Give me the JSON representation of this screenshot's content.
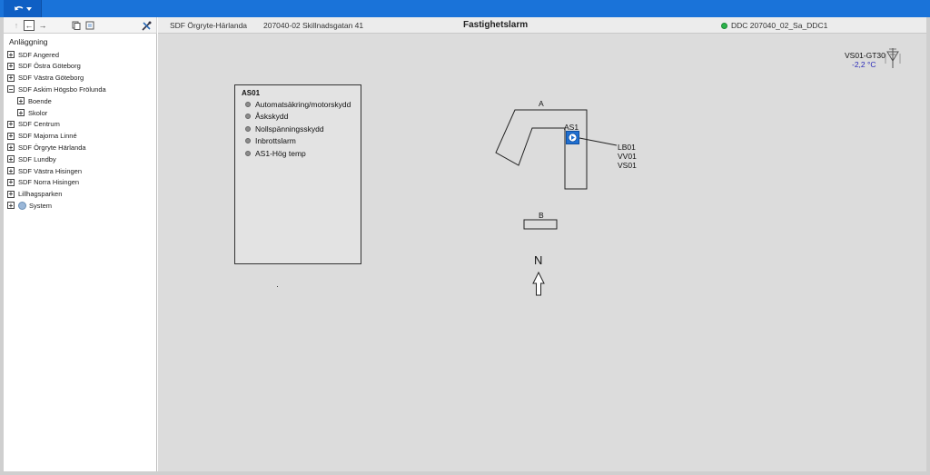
{
  "toolbar": {
    "up": "↑",
    "back": "←",
    "forward": "→"
  },
  "tree": {
    "root": "Anläggning",
    "items": [
      {
        "label": "SDF Angered",
        "exp": "+"
      },
      {
        "label": "SDF Östra Göteborg",
        "exp": "+"
      },
      {
        "label": "SDF Västra Göteborg",
        "exp": "+"
      },
      {
        "label": "SDF Askim Högsbo Frölunda",
        "exp": "−"
      },
      {
        "label": "Boende",
        "exp": "+"
      },
      {
        "label": "Skolor",
        "exp": "+"
      },
      {
        "label": "SDF Centrum",
        "exp": "+"
      },
      {
        "label": "SDF Majorna Linné",
        "exp": "+"
      },
      {
        "label": "SDF Örgryte Härlanda",
        "exp": "+"
      },
      {
        "label": "SDF Lundby",
        "exp": "+"
      },
      {
        "label": "SDF Västra Hisingen",
        "exp": "+"
      },
      {
        "label": "SDF Norra Hisingen",
        "exp": "+"
      },
      {
        "label": "Lillhagsparken",
        "exp": "+"
      },
      {
        "label": "System",
        "exp": "+"
      }
    ]
  },
  "header": {
    "site": "SDF Örgryte-Härlanda",
    "address": "207040-02 Skillnadsgatan 41",
    "title": "Fastighetslarm",
    "ddc": "DDC 207040_02_Sa_DDC1"
  },
  "alarms": {
    "title": "AS01",
    "items": [
      "Automatsäkring/motorskydd",
      "Åskskydd",
      "Nollspänningsskydd",
      "Inbrottslarm",
      "AS1-Hög temp"
    ]
  },
  "floorplan": {
    "building_a": "A",
    "building_b": "B",
    "as1_label": "AS1",
    "links": [
      "LB01",
      "VV01",
      "VS01"
    ],
    "north": "N"
  },
  "sensor": {
    "name": "VS01-GT30",
    "value": "-2,2 °C"
  },
  "colors": {
    "topbar": "#1a73d9",
    "canvas": "#dcdcdc",
    "status_ok": "#2bb34a",
    "sensor_value": "#2a2ab8"
  }
}
